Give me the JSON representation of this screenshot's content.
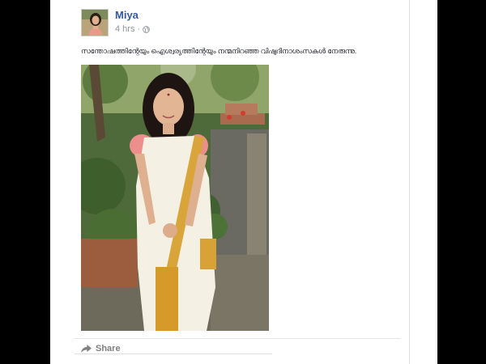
{
  "post": {
    "author": "Miya",
    "time": "4 hrs",
    "separator": "·",
    "privacy_icon": "globe-icon",
    "text": "സന്തോഷത്തിന്റേയും ഐശ്വര്യത്തിന്റേയും നന്മനിറഞ്ഞ വിഷുദിനാശംസകൾ നേരുന്നു.",
    "photo_description": "woman in kasavu saree in garden"
  },
  "actions": {
    "share_label": "Share",
    "share_icon": "share-arrow-icon"
  },
  "colors": {
    "author": "#365899",
    "meta": "#90949c",
    "action": "#7f7f7f"
  }
}
